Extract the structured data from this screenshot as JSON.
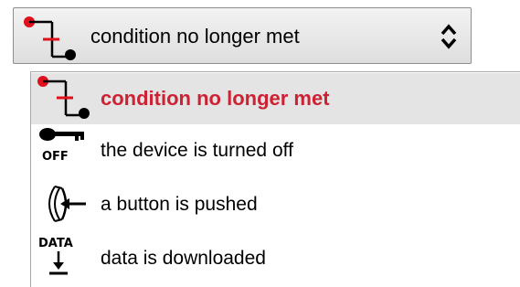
{
  "select": {
    "value": "condition no longer met",
    "icon": "condition-icon",
    "arrow_icon": "updown-chevron-icon"
  },
  "options": [
    {
      "label": "condition no longer met",
      "icon": "condition-icon",
      "selected": true
    },
    {
      "label": "the device is turned off",
      "icon": "key-off-icon",
      "icon_text": "OFF",
      "selected": false
    },
    {
      "label": "a button is pushed",
      "icon": "button-push-icon",
      "selected": false
    },
    {
      "label": "data is downloaded",
      "icon": "data-download-icon",
      "icon_text": "DATA",
      "selected": false
    }
  ],
  "colors": {
    "selected_text": "#cc2233",
    "selected_row": "#e4e4e4",
    "icon_red": "#e0101c"
  }
}
